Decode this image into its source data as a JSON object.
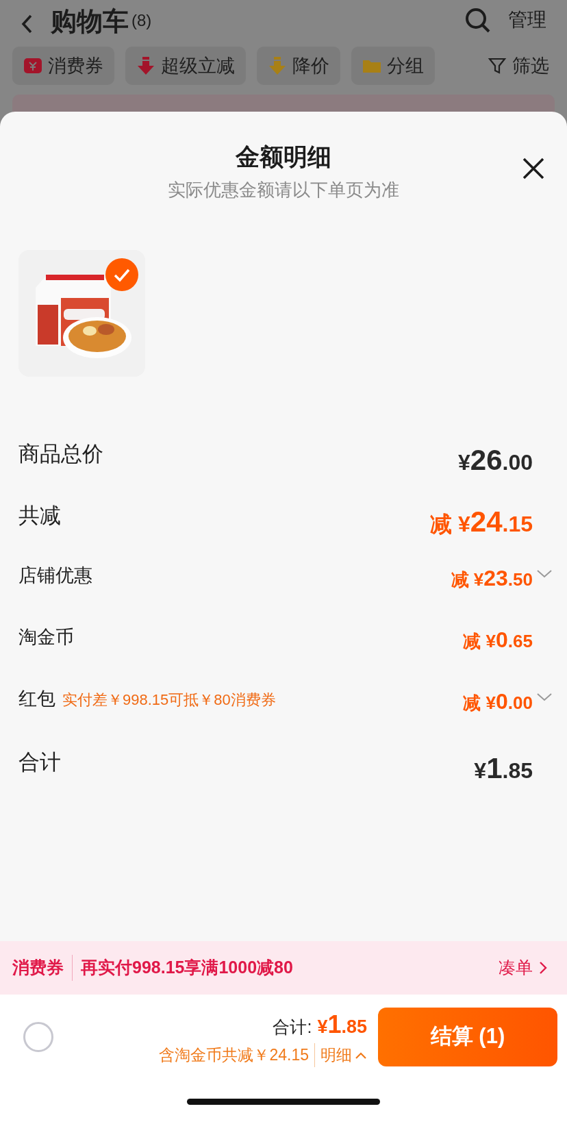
{
  "background": {
    "title": "购物车",
    "count": "(8)",
    "action": "管理",
    "chips": [
      {
        "kind": "coupon",
        "label": "消费券"
      },
      {
        "kind": "super",
        "label": "超级立减"
      },
      {
        "kind": "drop",
        "label": "降价"
      },
      {
        "kind": "group",
        "label": "分组"
      },
      {
        "kind": "filter",
        "label": "筛选"
      }
    ]
  },
  "sheet": {
    "title": "金额明细",
    "subtitle": "实际优惠金额请以下单页为准",
    "product": {
      "checked": true
    },
    "rows": [
      {
        "kind": "major",
        "label": "商品总价",
        "discount": false,
        "prefix": "",
        "currency": "¥",
        "whole": "26",
        "fraction": ".00",
        "expandable": false
      },
      {
        "kind": "major",
        "label": "共减",
        "discount": true,
        "prefix": "减",
        "currency": "¥",
        "whole": "24",
        "fraction": ".15",
        "expandable": false
      },
      {
        "kind": "minor",
        "label": "店铺优惠",
        "discount": true,
        "prefix": "减",
        "currency": "¥",
        "whole": "23",
        "fraction": ".50",
        "expandable": true
      },
      {
        "kind": "minor",
        "label": "淘金币",
        "discount": true,
        "prefix": "减",
        "currency": "¥",
        "whole": "0",
        "fraction": ".65",
        "expandable": false
      },
      {
        "kind": "minor",
        "label": "红包",
        "note": "实付差￥998.15可抵￥80消费券",
        "discount": true,
        "prefix": "减",
        "currency": "¥",
        "whole": "0",
        "fraction": ".00",
        "expandable": true
      },
      {
        "kind": "major",
        "label": "合计",
        "discount": false,
        "prefix": "",
        "currency": "¥",
        "whole": "1",
        "fraction": ".85",
        "expandable": false
      }
    ]
  },
  "promo": {
    "tag": "消费券",
    "text": "再实付998.15享满1000减80",
    "link": "凑单"
  },
  "footer": {
    "select_all": {
      "checked": false
    },
    "total_label": "合计:",
    "currency": "¥",
    "whole": "1",
    "fraction": ".85",
    "saving": "含淘金币共减￥24.15",
    "details": "明细",
    "checkout": "结算 (1)"
  }
}
